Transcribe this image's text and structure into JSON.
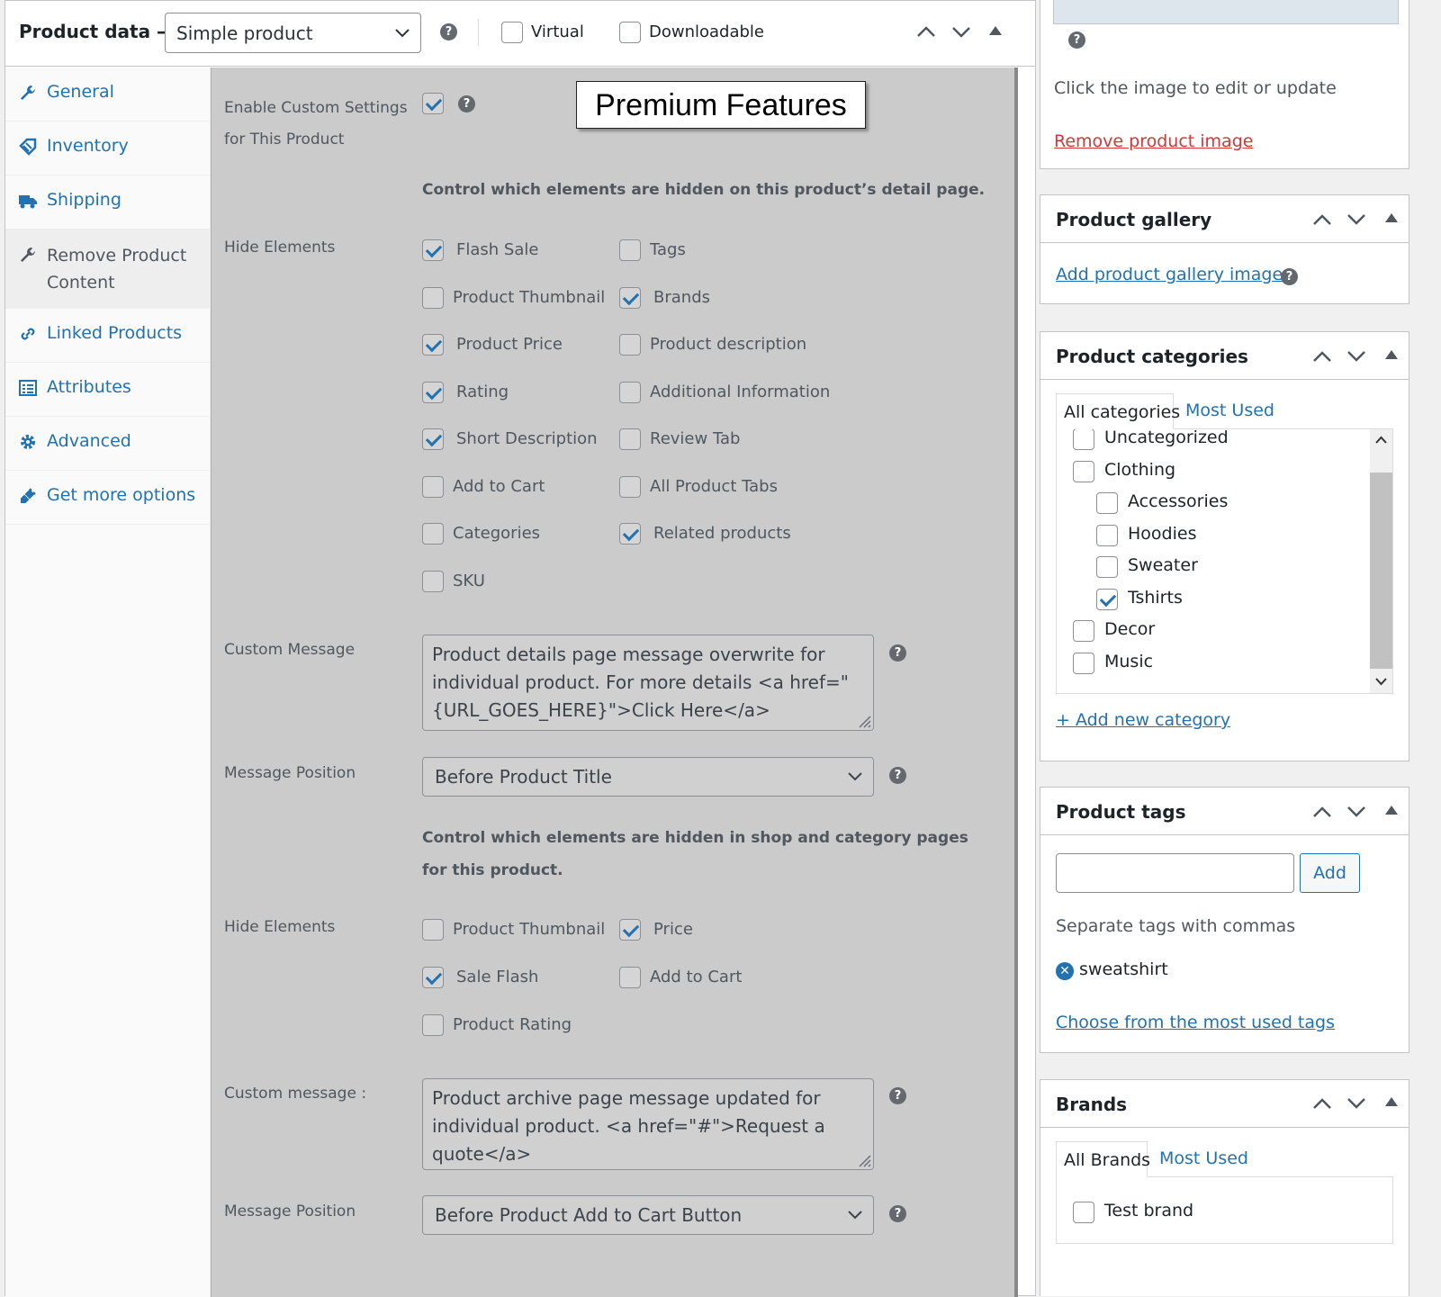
{
  "product_data": {
    "title": "Product data —",
    "type_select": "Simple product",
    "virtual_label": "Virtual",
    "downloadable_label": "Downloadable"
  },
  "tabs": [
    {
      "label": "General",
      "icon": "wrench-icon"
    },
    {
      "label": "Inventory",
      "icon": "tag-icon"
    },
    {
      "label": "Shipping",
      "icon": "truck-icon"
    },
    {
      "label": "Remove Product Content",
      "icon": "wrench-icon"
    },
    {
      "label": "Linked Products",
      "icon": "link-icon"
    },
    {
      "label": "Attributes",
      "icon": "list-icon"
    },
    {
      "label": "Advanced",
      "icon": "gear-icon"
    },
    {
      "label": "Get more options",
      "icon": "plugin-icon"
    }
  ],
  "panel": {
    "premium_banner": "Premium Features",
    "enable_label": "Enable Custom Settings for This Product",
    "detail_note": "Control which elements are hidden on this product’s detail page.",
    "hide_label_1": "Hide Elements",
    "detail_options": [
      {
        "label": "Flash Sale",
        "checked": true
      },
      {
        "label": "Tags",
        "checked": false
      },
      {
        "label": "Product Thumbnail",
        "checked": false
      },
      {
        "label": "Brands",
        "checked": true
      },
      {
        "label": "Product Price",
        "checked": true
      },
      {
        "label": "Product description",
        "checked": false
      },
      {
        "label": "Rating",
        "checked": true
      },
      {
        "label": "Additional Information",
        "checked": false
      },
      {
        "label": "Short Description",
        "checked": true
      },
      {
        "label": "Review Tab",
        "checked": false
      },
      {
        "label": "Add to Cart",
        "checked": false
      },
      {
        "label": "All Product Tabs",
        "checked": false
      },
      {
        "label": "Categories",
        "checked": false
      },
      {
        "label": "Related products",
        "checked": true
      },
      {
        "label": "SKU",
        "checked": false
      }
    ],
    "custom_message_label": "Custom Message",
    "custom_message_value": "Product details page message overwrite for individual product. For more details <a href=\"{URL_GOES_HERE}\">Click Here</a>",
    "message_position_label": "Message Position",
    "message_position_value": "Before Product Title",
    "shop_note": "Control which elements are hidden in shop and category pages for this product.",
    "hide_label_2": "Hide Elements",
    "shop_options": [
      {
        "label": "Product Thumbnail",
        "checked": false
      },
      {
        "label": "Price",
        "checked": true
      },
      {
        "label": "Sale Flash",
        "checked": true
      },
      {
        "label": "Add to Cart",
        "checked": false
      },
      {
        "label": "Product Rating",
        "checked": false
      }
    ],
    "custom_message2_label": "Custom message :",
    "custom_message2_value": "Product archive page message updated for individual product. <a href=\"#\">Request a quote</a>",
    "message_position2_label": "Message Position",
    "message_position2_value": "Before Product Add to Cart Button"
  },
  "product_image": {
    "hint": "Click the image to edit or update",
    "remove_link": "Remove product image"
  },
  "gallery": {
    "title": "Product gallery",
    "add_link": "Add product gallery images"
  },
  "categories": {
    "title": "Product categories",
    "tab_all": "All categories",
    "tab_most": "Most Used",
    "items": [
      {
        "label": "Uncategorized",
        "checked": false,
        "child": false
      },
      {
        "label": "Clothing",
        "checked": false,
        "child": false
      },
      {
        "label": "Accessories",
        "checked": false,
        "child": true
      },
      {
        "label": "Hoodies",
        "checked": false,
        "child": true
      },
      {
        "label": "Sweater",
        "checked": false,
        "child": true
      },
      {
        "label": "Tshirts",
        "checked": true,
        "child": true
      },
      {
        "label": "Decor",
        "checked": false,
        "child": false
      },
      {
        "label": "Music",
        "checked": false,
        "child": false
      }
    ],
    "add_link": "+ Add new category"
  },
  "tags": {
    "title": "Product tags",
    "add_button": "Add",
    "hint": "Separate tags with commas",
    "tag": "sweatshirt",
    "choose_link": "Choose from the most used tags"
  },
  "brands": {
    "title": "Brands",
    "tab_all": "All Brands",
    "tab_most": "Most Used",
    "item": "Test brand"
  },
  "colors": {
    "link": "#2271b1",
    "danger": "#d63638",
    "panel_overlay": "#cbcbcb"
  }
}
